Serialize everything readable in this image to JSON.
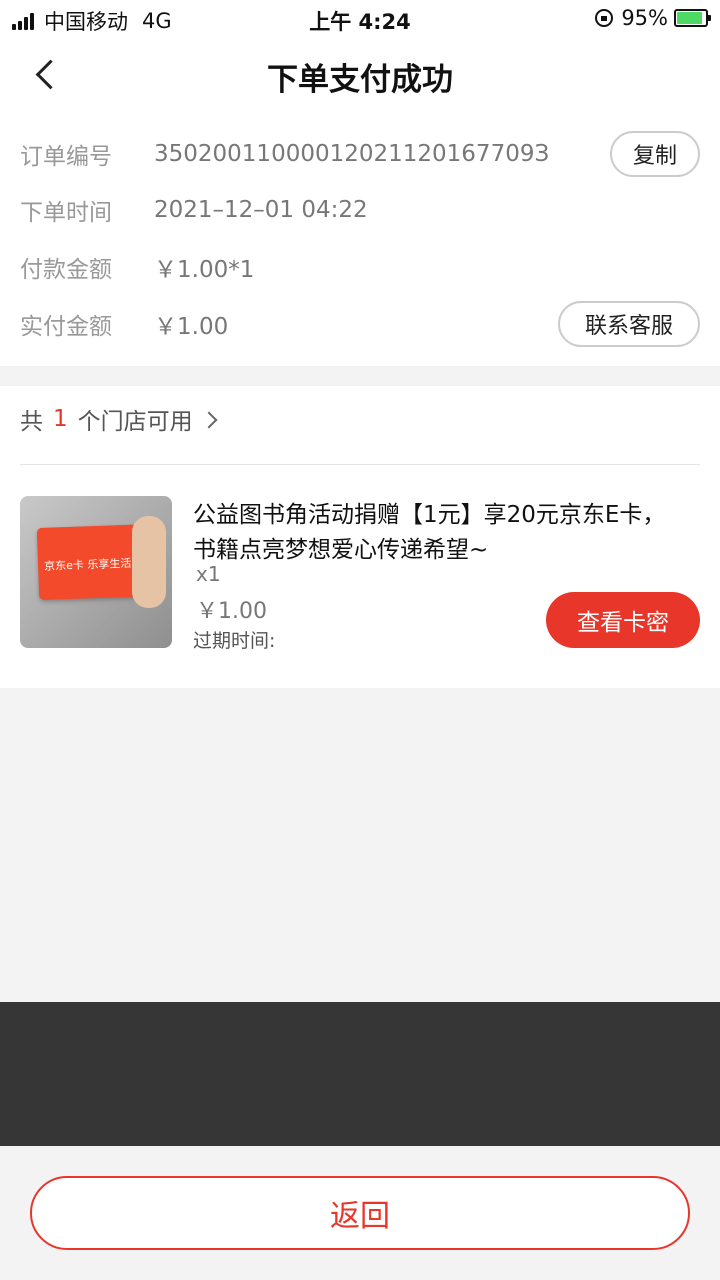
{
  "status_bar": {
    "carrier": "中国移动",
    "network": "4G",
    "time": "上午 4:24",
    "battery": "95%",
    "battery_level": 0.95
  },
  "nav": {
    "title": "下单支付成功"
  },
  "order": {
    "number_label": "订单编号",
    "number_value": "35020011000012021120167709З",
    "time_label": "下单时间",
    "time_value": "2021–12–01 04:22",
    "amount_label": "付款金额",
    "amount_value": "￥1.00*1",
    "paid_label": "实付金额",
    "paid_value": "￥1.00",
    "copy_button": "复制",
    "service_button": "联系客服"
  },
  "stores": {
    "prefix": "共",
    "count": "1",
    "suffix": "个门店可用"
  },
  "product": {
    "title": "公益图书角活动捐赠【1元】享20元京东E卡，书籍点亮梦想爱心传递希望~",
    "quantity": "x1",
    "price": "￥1.00",
    "expiry_label": "过期时间:",
    "card_text": "京东e卡 乐享生活",
    "view_button": "查看卡密"
  },
  "footer": {
    "return_button": "返回"
  },
  "colors": {
    "accent": "#e8362b",
    "dark_panel": "#363636"
  }
}
